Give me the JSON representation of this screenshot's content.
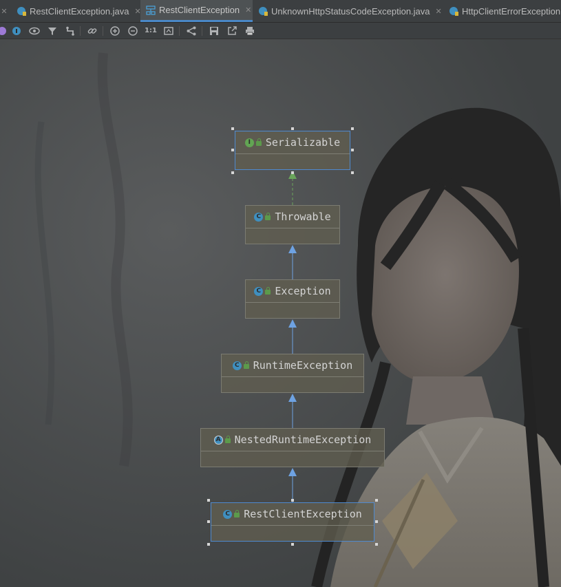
{
  "tabs": [
    {
      "label": "RestClientException.java",
      "active": false,
      "icon": "java-class-icon"
    },
    {
      "label": "RestClientException",
      "active": true,
      "icon": "diagram-icon"
    },
    {
      "label": "UnknownHttpStatusCodeException.java",
      "active": false,
      "icon": "java-class-icon"
    },
    {
      "label": "HttpClientErrorException",
      "active": false,
      "icon": "java-class-icon"
    }
  ],
  "tab_close_glyph": "✕",
  "toolbar": {
    "actual_size_label": "1:1",
    "icons": [
      "scope-icon",
      "info-icon",
      "eye-icon",
      "filter-icon",
      "route-icon",
      "link-icon",
      "zoom-in-icon",
      "zoom-out-icon",
      "actual-size-icon",
      "fit-content-icon",
      "layout-icon",
      "save-icon",
      "export-icon",
      "print-icon"
    ]
  },
  "diagram": {
    "nodes": [
      {
        "name": "Serializable",
        "kind": "interface",
        "kind_glyph": "I",
        "selected": true
      },
      {
        "name": "Throwable",
        "kind": "class",
        "kind_glyph": "C",
        "selected": false
      },
      {
        "name": "Exception",
        "kind": "class",
        "kind_glyph": "C",
        "selected": false
      },
      {
        "name": "RuntimeException",
        "kind": "class",
        "kind_glyph": "C",
        "selected": false
      },
      {
        "name": "NestedRuntimeException",
        "kind": "abstract",
        "kind_glyph": "A",
        "selected": false
      },
      {
        "name": "RestClientException",
        "kind": "class",
        "kind_glyph": "C",
        "selected": true
      }
    ],
    "edges": [
      {
        "from": "Throwable",
        "to": "Serializable",
        "type": "implements"
      },
      {
        "from": "Exception",
        "to": "Throwable",
        "type": "extends"
      },
      {
        "from": "RuntimeException",
        "to": "Exception",
        "type": "extends"
      },
      {
        "from": "NestedRuntimeException",
        "to": "RuntimeException",
        "type": "extends"
      },
      {
        "from": "RestClientException",
        "to": "NestedRuntimeException",
        "type": "extends"
      }
    ]
  },
  "colors": {
    "tab_active_underline": "#4a88c7",
    "extends_edge": "#6ea2e2",
    "implements_edge": "#6aa55b",
    "interface_icon": "#62a553",
    "class_icon": "#3f8fbf"
  }
}
